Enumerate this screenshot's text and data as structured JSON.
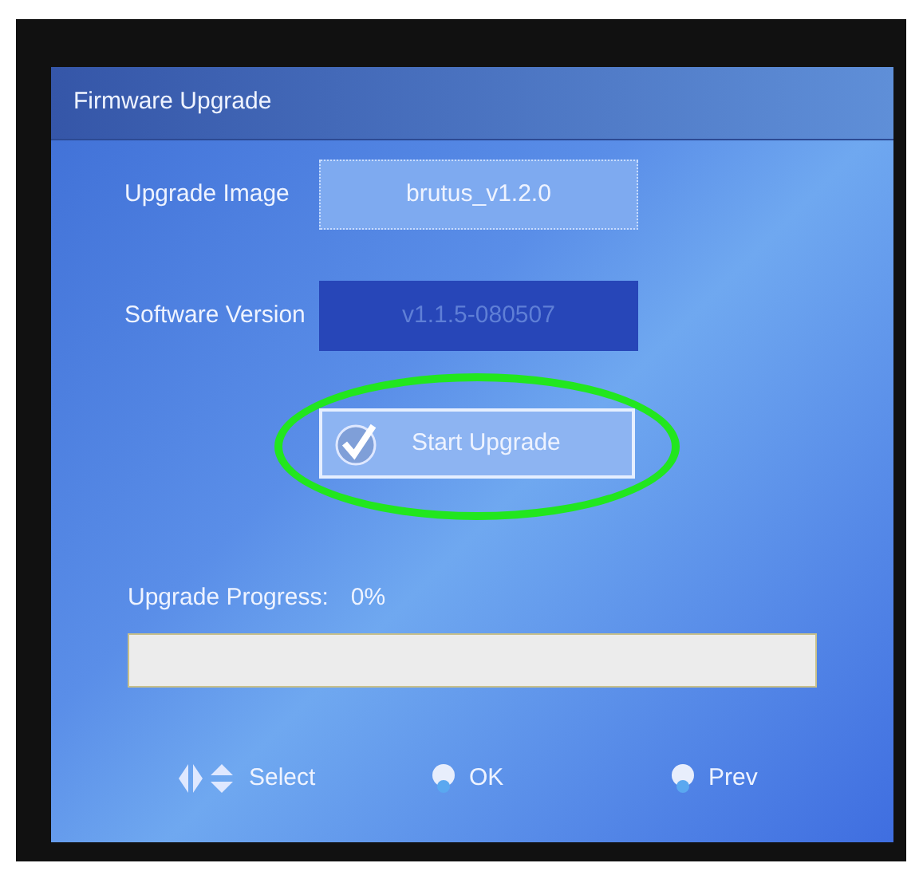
{
  "window": {
    "title": "Firmware Upgrade"
  },
  "fields": [
    {
      "label": "Upgrade Image",
      "value": "brutus_v1.2.0",
      "kind": "input"
    },
    {
      "label": "Software Version",
      "value": "v1.1.5-080507",
      "kind": "readonly"
    }
  ],
  "start_button": {
    "label": "Start Upgrade",
    "selected": true,
    "circled": true
  },
  "progress": {
    "label": "Upgrade Progress:",
    "reading": "0%",
    "level": 0
  },
  "footer_hints": [
    {
      "kind": "arrows",
      "label": "Select"
    },
    {
      "kind": "ok",
      "label": "OK"
    },
    {
      "kind": "menu",
      "label": "Prev"
    }
  ]
}
